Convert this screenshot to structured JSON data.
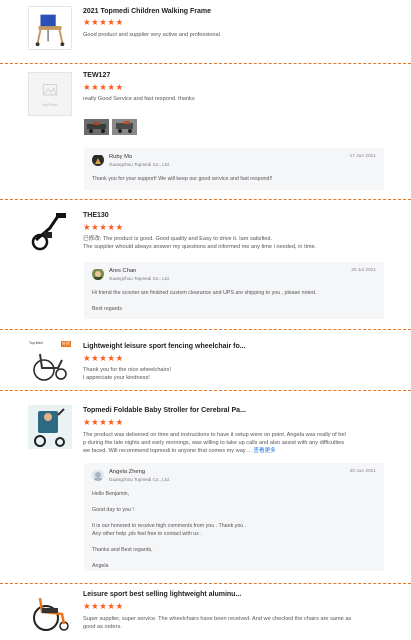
{
  "colors": {
    "star": "#ff5a1f",
    "divider": "#e8761e",
    "link": "#1a73e8"
  },
  "reviews": [
    {
      "title": "2021 Topmedi Children Walking Frame",
      "stars": "★★★★★",
      "text": [
        "Good product and supplier very active and professional"
      ],
      "thumb_icon": "walking-frame-image"
    },
    {
      "title": "TEW127",
      "stars": "★★★★★",
      "text": [
        "really Good Service and fast respond. thanks"
      ],
      "thumb_label": "NoPhoto",
      "reply": {
        "name": "Ruby Mo",
        "company": "Guangzhou Topmedi Co., Ltd.",
        "date": "17 Jun 2021",
        "text": [
          "Thank you for your support! We will keep our good service and fast respond!!"
        ]
      }
    },
    {
      "title": "THE130",
      "stars": "★★★★★",
      "text": [
        "已修改: The product is good. Good quality and Easy to drive it. Iam satisfied.",
        "The supplier whould always answer my questions and informed me any time i needed, in time."
      ],
      "reply": {
        "name": "Ares Chan",
        "company": "Guangzhou Topmedi Co., Ltd.",
        "date": "20 Jul 2021",
        "text": [
          "Hi friend the scooter are finished custom clearance and UPS are shipping to you , please noted.",
          "",
          "Best regards"
        ]
      }
    },
    {
      "title": "Lightweight leisure sport fencing wheelchair fo...",
      "stars": "★★★★★",
      "text": [
        "Thank you for the nice wheelchairs!",
        "I appreciate your kindness!"
      ],
      "thumb_caption": "Top-Med",
      "thumb_badge": "外贸"
    },
    {
      "title": "Topmedi Foldable Baby Stroller for Cerebral Pa...",
      "stars": "★★★★★",
      "text": [
        "The product was delivered on time and instructions to have it setup were on point. Angela was really of hel",
        "p during the late nights and early mornings, was willing to take up calls and also assist with any difficulties",
        "we faced. Will recommend topmedi to anyone that comes my way ..."
      ],
      "more_link": "查看更多",
      "reply": {
        "name": "Angela Zheng",
        "company": "Guangzhou Topmedi Co., Ltd.",
        "date": "30 Jun 2021",
        "text": [
          "Hello Benjamin,",
          "",
          "Good day to you !",
          "",
          "It is our honored to receive high comments from you . Thank you .",
          "Any other help ,pls feel free to contact with us .",
          "",
          "Thanks and Best regards,",
          "",
          "Angela"
        ]
      }
    },
    {
      "title": "Leisure sport best selling lightweight aluminu...",
      "stars": "★★★★★",
      "text": [
        "Super supplier, super service. The wheelchairs have been received. And we checked the chairs are same as",
        "good as orders."
      ]
    }
  ]
}
